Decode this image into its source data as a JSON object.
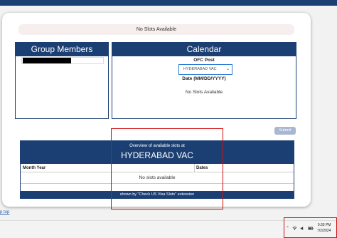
{
  "status": {
    "no_slots": "No Slots Available"
  },
  "group_members": {
    "title": "Group Members"
  },
  "calendar": {
    "title": "Calendar",
    "ofc_label": "OFC Post",
    "ofc_value": "HYDERABAD VAC",
    "date_label": "Date (MM/DD/YYYY)",
    "status": "No Slots Available"
  },
  "submit_label": "Submit",
  "overview": {
    "subtitle": "Overview of available slots at",
    "title": "HYDERABAD VAC",
    "col_month_year": "Month Year",
    "col_dates": "Dates",
    "empty": "No slots available",
    "footer": "shown by \"Check US Visa Slots\" extension"
  },
  "back_to_top": "p top",
  "taskbar": {
    "time": "9:33 PM",
    "date": "7/2/2024"
  },
  "tray_icons": [
    "chevron-up-icon",
    "wifi-icon",
    "volume-icon",
    "battery-icon"
  ],
  "colors": {
    "brand": "#1c3f73",
    "highlight": "#d01010",
    "select_border": "#2b7ad6"
  }
}
